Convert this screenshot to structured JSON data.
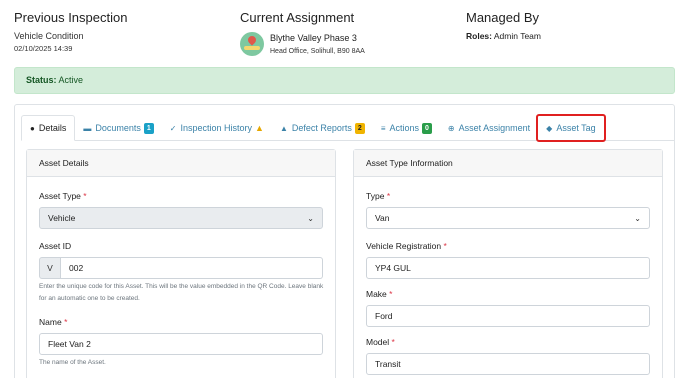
{
  "header": {
    "inspection": {
      "title": "Previous Inspection",
      "label": "Vehicle Condition",
      "date": "02/10/2025 14:39"
    },
    "assignment": {
      "title": "Current Assignment",
      "name": "Blythe Valley Phase 3",
      "address": "Head Office, Solihull, B90 8AA"
    },
    "managed": {
      "title": "Managed By",
      "roles_label": "Roles:",
      "roles_value": "Admin Team"
    }
  },
  "status": {
    "label": "Status:",
    "value": "Active"
  },
  "tabs": [
    {
      "label": "Details",
      "icon": "info-circle-icon"
    },
    {
      "label": "Documents",
      "icon": "folder-icon",
      "badge": "1"
    },
    {
      "label": "Inspection History",
      "icon": "check-icon",
      "warning": true
    },
    {
      "label": "Defect Reports",
      "icon": "warning-triangle-icon",
      "badge": "2"
    },
    {
      "label": "Actions",
      "icon": "list-icon",
      "badge": "0"
    },
    {
      "label": "Asset Assignment",
      "icon": "plus-circle-icon"
    },
    {
      "label": "Asset Tag",
      "icon": "tag-icon"
    }
  ],
  "details": {
    "title": "Asset Details",
    "asset_type_label": "Asset Type",
    "asset_type_value": "Vehicle",
    "asset_id_label": "Asset ID",
    "asset_id_prefix": "V",
    "asset_id_value": "002",
    "asset_id_help": "Enter the unique code for this Asset. This will be the value embedded in the QR Code. Leave blank for an automatic one to be created.",
    "name_label": "Name",
    "name_value": "Fleet Van 2",
    "name_help": "The name of the Asset."
  },
  "type_info": {
    "title": "Asset Type Information",
    "type_label": "Type",
    "type_value": "Van",
    "reg_label": "Vehicle Registration",
    "reg_value": "YP4 GUL",
    "make_label": "Make",
    "make_value": "Ford",
    "model_label": "Model",
    "model_value": "Transit"
  },
  "required_marker": "*"
}
